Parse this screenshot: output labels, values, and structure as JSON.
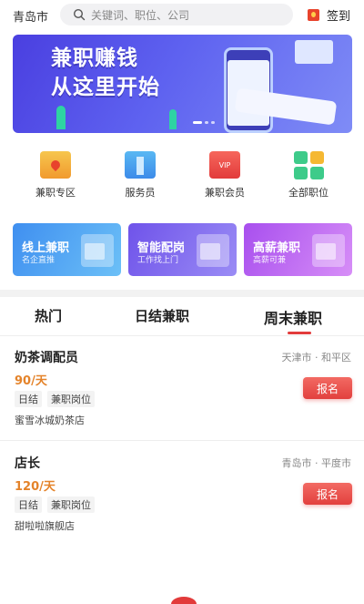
{
  "header": {
    "city": "青岛市",
    "search_placeholder": "关键词、职位、公司",
    "sign_label": "签到"
  },
  "banner": {
    "line1": "兼职赚钱",
    "line2": "从这里开始",
    "slide_count": 3,
    "active_slide": 1
  },
  "quick_entries": [
    {
      "label": "兼职专区",
      "icon": "map-pin-folder-icon"
    },
    {
      "label": "服务员",
      "icon": "waiter-uniform-icon"
    },
    {
      "label": "兼职会员",
      "icon": "vip-card-icon"
    },
    {
      "label": "全部职位",
      "icon": "grid-apps-icon"
    }
  ],
  "quick_vip_text": "VIP",
  "feature_cards": [
    {
      "title": "线上兼职",
      "subtitle": "名企直推",
      "color": "#4aa2f0"
    },
    {
      "title": "智能配岗",
      "subtitle": "工作找上门",
      "color": "#7b63ef"
    },
    {
      "title": "高薪兼职",
      "subtitle": "高薪可兼",
      "color": "#b85cf0"
    }
  ],
  "tabs": [
    {
      "label": "热门",
      "active": false
    },
    {
      "label": "日结兼职",
      "active": false
    },
    {
      "label": "周末兼职",
      "active": true
    }
  ],
  "jobs": [
    {
      "title": "奶茶调配员",
      "location": "天津市 · 和平区",
      "pay": "90/天",
      "tags": [
        "日结",
        "兼职岗位"
      ],
      "company": "蜜雪冰城奶茶店",
      "apply_label": "报名"
    },
    {
      "title": "店长",
      "location": "青岛市 · 平度市",
      "pay": "120/天",
      "tags": [
        "日结",
        "兼职岗位"
      ],
      "company": "甜啦啦旗舰店",
      "apply_label": "报名"
    }
  ],
  "colors": {
    "accent": "#e23b3b",
    "pay": "#e4832a",
    "banner": "#5e62f0"
  }
}
